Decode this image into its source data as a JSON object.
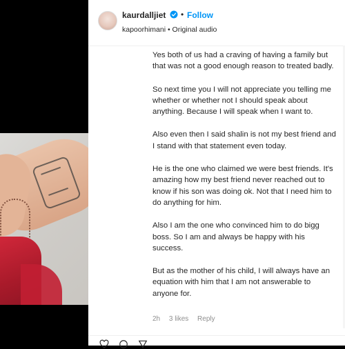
{
  "header": {
    "username": "kaurdalljiet",
    "separator": "•",
    "follow_label": "Follow",
    "audio": "kapoorhimani • Original audio"
  },
  "comment": {
    "paragraphs": [
      "Yes both of us had a craving of having a family but that was not a good enough reason to treated badly.",
      "So next time you I will not appreciate you telling me whether or whether not I should speak about anything. Because I will speak when I want to.",
      "Also even then I said shalin is not my best friend and I stand with that statement even today.",
      "He is the one who claimed we were best friends. It's amazing how my best friend never reached out to know if his son was doing ok. Not that I need him to do anything for him.",
      "Also I am the one who convinced him to do bigg boss. So I am and always be happy with his success.",
      "But as the mother of his child, I will always have an equation with him that I am not answerable to anyone for."
    ],
    "time": "2h",
    "likes": "3 likes",
    "reply_label": "Reply"
  },
  "colors": {
    "follow_blue": "#0095f6",
    "verified_blue": "#0095f6",
    "text": "#262626",
    "meta": "#8e8e8e"
  },
  "icons": {
    "verified": "verified-badge-icon",
    "like": "heart-icon",
    "comment": "comment-icon",
    "share": "share-icon"
  }
}
